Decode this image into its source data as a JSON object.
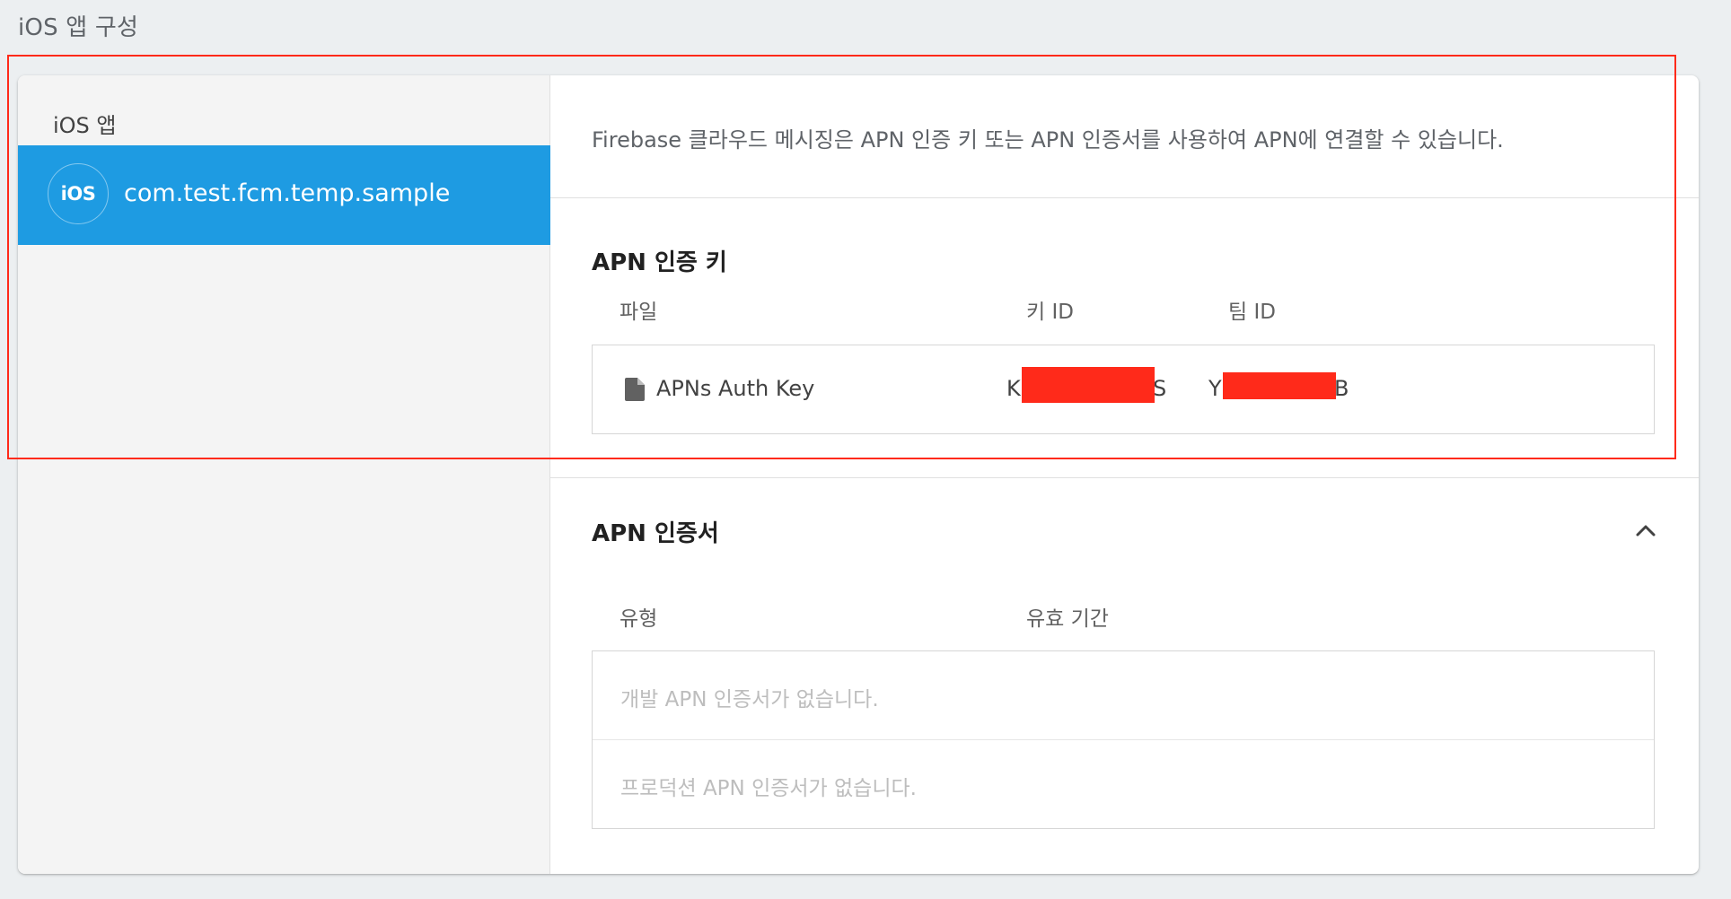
{
  "page": {
    "title": "iOS 앱 구성"
  },
  "sidebar": {
    "heading": "iOS 앱",
    "app": {
      "icon_text": "iOS",
      "bundle_id": "com.test.fcm.temp.sample"
    }
  },
  "main": {
    "intro": "Firebase 클라우드 메시징은 APN 인증 키 또는 APN 인증서를 사용하여 APN에 연결할 수 있습니다.",
    "auth_key": {
      "title": "APN 인증 키",
      "columns": {
        "file": "파일",
        "key_id": "키 ID",
        "team_id": "팀 ID"
      },
      "row": {
        "file_name": "APNs Auth Key",
        "key_id_prefix": "K",
        "key_id_suffix": "S",
        "team_id_prefix": "Y",
        "team_id_suffix": "B"
      }
    },
    "certificates": {
      "title": "APN 인증서",
      "columns": {
        "type": "유형",
        "expiry": "유효 기간"
      },
      "rows": [
        "개발 APN 인증서가 없습니다.",
        "프로덕션 APN 인증서가 없습니다."
      ]
    }
  },
  "colors": {
    "accent": "#1e9be2",
    "redaction": "#ff2a1a"
  },
  "icons": {
    "file": "file-icon",
    "collapse": "chevron-up-icon",
    "app": "ios-icon"
  }
}
